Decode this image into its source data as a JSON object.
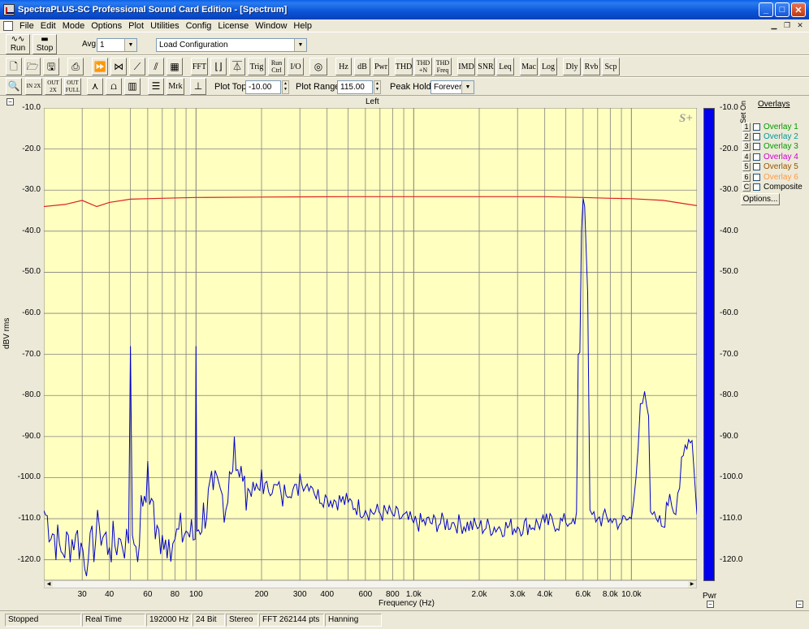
{
  "window": {
    "title": "SpectraPLUS-SC Professional Sound Card Edition - [Spectrum]",
    "minimize": "_",
    "maximize": "□",
    "close": "✕"
  },
  "menu": [
    "File",
    "Edit",
    "Mode",
    "Options",
    "Plot",
    "Utilities",
    "Config",
    "License",
    "Window",
    "Help"
  ],
  "toolbar1": {
    "run_label": "Run",
    "stop_label": "Stop",
    "avg_label": "Avg",
    "avg_value": "1",
    "config_value": "Load Configuration"
  },
  "toolbar2": {
    "text_buttons": [
      "FFT",
      "Trig",
      "Run Ctrl",
      "I/O",
      "Hz",
      "dB",
      "Pwr",
      "THD",
      "THD +N",
      "THD Freq",
      "IMD",
      "SNR",
      "Leq",
      "Mac",
      "Log",
      "Dly",
      "Rvb",
      "Scp"
    ]
  },
  "toolbar3": {
    "zoom_buttons": [
      "IN 2X",
      "OUT 2X",
      "OUT FULL"
    ],
    "mrk_label": "Mrk",
    "plot_top_label": "Plot Top:",
    "plot_top_value": "-10.00",
    "plot_range_label": "Plot Range:",
    "plot_range_value": "115.00",
    "peak_hold_label": "Peak Hold:",
    "peak_hold_value": "Forever"
  },
  "plot": {
    "channel_title": "Left",
    "logo": "S+",
    "ylabel": "dBV rms",
    "xlabel": "Frequency (Hz)",
    "yticks": [
      "-10.0",
      "-20.0",
      "-30.0",
      "-40.0",
      "-50.0",
      "-60.0",
      "-70.0",
      "-80.0",
      "-90.0",
      "-100.0",
      "-110.0",
      "-120.0"
    ],
    "xticks": [
      {
        "f": 30,
        "label": "30"
      },
      {
        "f": 40,
        "label": "40"
      },
      {
        "f": 60,
        "label": "60"
      },
      {
        "f": 80,
        "label": "80"
      },
      {
        "f": 100,
        "label": "100"
      },
      {
        "f": 200,
        "label": "200"
      },
      {
        "f": 300,
        "label": "300"
      },
      {
        "f": 400,
        "label": "400"
      },
      {
        "f": 600,
        "label": "600"
      },
      {
        "f": 800,
        "label": "800"
      },
      {
        "f": 1000,
        "label": "1.0k"
      },
      {
        "f": 2000,
        "label": "2.0k"
      },
      {
        "f": 3000,
        "label": "3.0k"
      },
      {
        "f": 4000,
        "label": "4.0k"
      },
      {
        "f": 6000,
        "label": "6.0k"
      },
      {
        "f": 8000,
        "label": "8.0k"
      },
      {
        "f": 10000,
        "label": "10.0k"
      }
    ],
    "meter_label": "Pwr",
    "colors": {
      "background": "#ffffc0",
      "grid": "#808080",
      "spectrum": "#0000cc",
      "peak_hold": "#dd2222",
      "meter": "#0000ee"
    }
  },
  "chart_data": {
    "type": "line",
    "title": "Left",
    "xlabel": "Frequency (Hz)",
    "ylabel": "dBV rms",
    "x_scale": "log",
    "xlim": [
      20,
      20000
    ],
    "ylim": [
      -125,
      -10
    ],
    "grid": true,
    "series": [
      {
        "color": "#0000cc",
        "x": [
          20,
          24,
          28,
          32,
          36,
          40,
          45,
          49,
          50,
          51,
          55,
          60,
          65,
          70,
          75,
          80,
          90,
          99,
          100,
          101,
          120,
          140,
          150,
          170,
          200,
          250,
          300,
          350,
          400,
          500,
          600,
          800,
          1000,
          1500,
          2000,
          3000,
          4000,
          5000,
          5400,
          5700,
          5900,
          6000,
          6100,
          6300,
          6600,
          7000,
          8000,
          9000,
          10000,
          10500,
          11000,
          11500,
          12000,
          13000,
          14000,
          15000,
          16000,
          17000,
          18000,
          19000,
          20000
        ],
        "y": [
          -108,
          -118,
          -114,
          -120,
          -112,
          -117,
          -115,
          -116,
          -68,
          -114,
          -116,
          -96,
          -115,
          -114,
          -115,
          -115,
          -113,
          -115,
          -68,
          -113,
          -103,
          -106,
          -90,
          -108,
          -98,
          -107,
          -99,
          -104,
          -105,
          -106,
          -108,
          -109,
          -111,
          -111,
          -112,
          -112,
          -111,
          -111,
          -110,
          -70,
          -40,
          -32,
          -34,
          -55,
          -109,
          -110,
          -110,
          -111,
          -110,
          -100,
          -82,
          -79,
          -85,
          -110,
          -112,
          -104,
          -109,
          -95,
          -93,
          -91,
          -109
        ]
      },
      {
        "color": "#dd2222",
        "x": [
          20,
          25,
          30,
          35,
          40,
          50,
          70,
          100,
          200,
          500,
          1000,
          2000,
          4000,
          6000,
          8000,
          10000,
          14000,
          20000
        ],
        "y": [
          -34,
          -33.5,
          -32.5,
          -34,
          -33,
          -32.2,
          -32,
          -31.8,
          -31.7,
          -31.6,
          -31.6,
          -31.6,
          -31.6,
          -31.8,
          -32,
          -32.1,
          -32.5,
          -33.8
        ]
      }
    ]
  },
  "overlays": {
    "title": "Overlays",
    "set_on_label": "Set On",
    "items": [
      {
        "num": "1",
        "label": "Overlay 1",
        "color": "#009900"
      },
      {
        "num": "2",
        "label": "Overlay 2",
        "color": "#009999"
      },
      {
        "num": "3",
        "label": "Overlay 3",
        "color": "#009900"
      },
      {
        "num": "4",
        "label": "Overlay 4",
        "color": "#cc00cc"
      },
      {
        "num": "5",
        "label": "Overlay 5",
        "color": "#995500"
      },
      {
        "num": "6",
        "label": "Overlay 6",
        "color": "#ff9944"
      },
      {
        "num": "C",
        "label": "Composite",
        "color": "#000000"
      }
    ],
    "options_label": "Options..."
  },
  "status": [
    "Stopped",
    "Real Time",
    "192000 Hz",
    "24 Bit",
    "Stereo",
    "FFT 262144 pts",
    "Hanning"
  ]
}
